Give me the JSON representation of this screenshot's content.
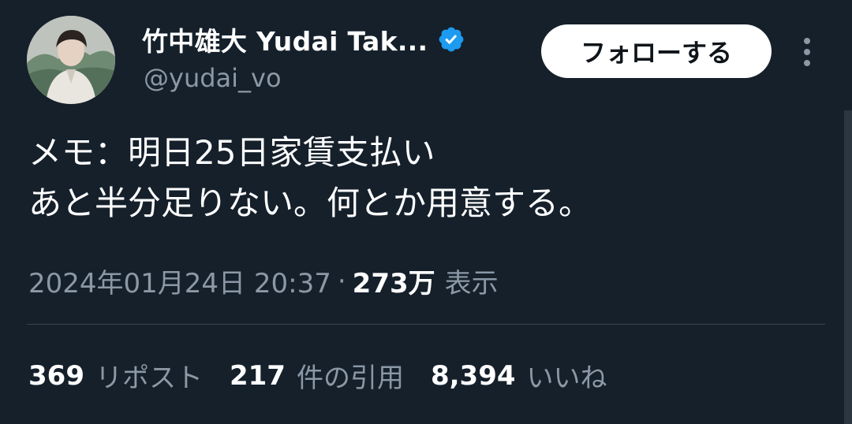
{
  "author": {
    "display_name": "竹中雄大 Yudai Tak...",
    "handle": "@yudai_vo",
    "verified_icon": "verified-badge-icon",
    "verified_color": "#1d9bf0"
  },
  "actions": {
    "follow_label": "フォローする",
    "more_icon": "more-vertical-icon"
  },
  "tweet": {
    "lines": [
      "メモ：明日25日家賃支払い",
      "あと半分足りない。何とか用意する。"
    ],
    "timestamp": "2024年01月24日 20:37",
    "separator": "·",
    "views_count": "273万",
    "views_label": "表示"
  },
  "stats": [
    {
      "count": "369",
      "label": "リポスト"
    },
    {
      "count": "217",
      "label": "件の引用"
    },
    {
      "count": "8,394",
      "label": "いいね"
    }
  ],
  "colors": {
    "background": "#15202b",
    "text_primary": "#ffffff",
    "text_secondary": "#8b98a5",
    "divider": "#38444d"
  }
}
